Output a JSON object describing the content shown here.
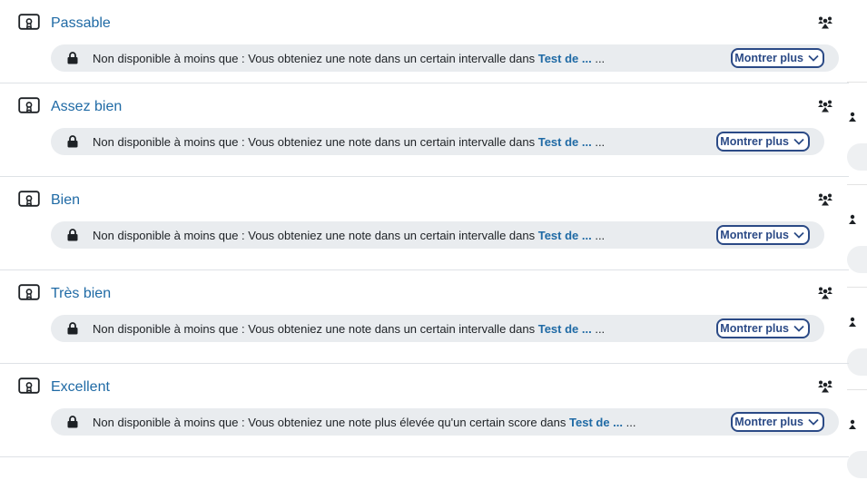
{
  "activities": [
    {
      "title": "Passable",
      "restriction_prefix": "Non disponible à moins que : Vous obteniez une note dans un certain intervalle dans ",
      "restriction_link": "Test de ...",
      "restriction_suffix": " ...",
      "more_label": "Montrer plus"
    },
    {
      "title": "Assez bien",
      "restriction_prefix": "Non disponible à moins que : Vous obteniez une note dans un certain intervalle dans ",
      "restriction_link": "Test de ...",
      "restriction_suffix": " ...",
      "more_label": "Montrer plus"
    },
    {
      "title": "Bien",
      "restriction_prefix": "Non disponible à moins que : Vous obteniez une note dans un certain intervalle dans ",
      "restriction_link": "Test de ...",
      "restriction_suffix": " ...",
      "more_label": "Montrer plus"
    },
    {
      "title": "Très bien",
      "restriction_prefix": "Non disponible à moins que : Vous obteniez une note dans un certain intervalle dans ",
      "restriction_link": "Test de ...",
      "restriction_suffix": " ...",
      "more_label": "Montrer plus"
    },
    {
      "title": "Excellent",
      "restriction_prefix": "Non disponible à moins que : Vous obteniez une note plus élevée qu'un certain score dans ",
      "restriction_link": "Test de ...",
      "restriction_suffix": " ...",
      "more_label": "Montrer plus"
    }
  ],
  "icons": {
    "activity": "badge-certificate-icon",
    "group": "group-mode-icon",
    "lock": "lock-icon",
    "expand": "chevron-down-icon"
  },
  "colors": {
    "link": "#1f6aa5",
    "button_border": "#2b4a86",
    "restriction_bg": "#e9ecef"
  }
}
